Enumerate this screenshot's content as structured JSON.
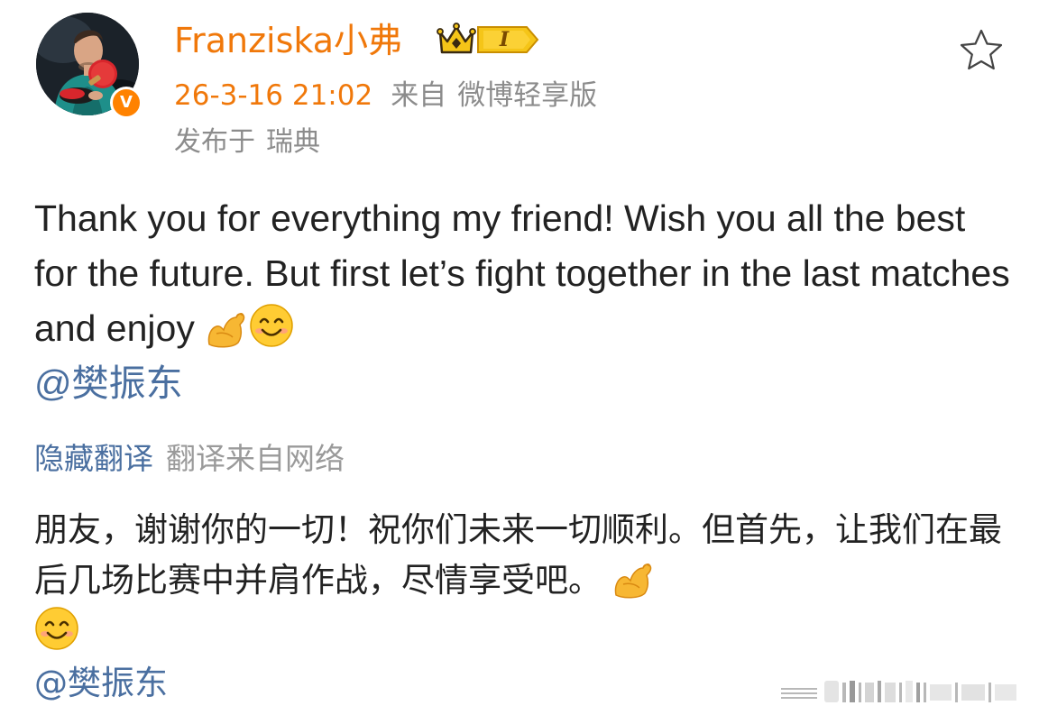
{
  "post": {
    "author": {
      "name": "Franziska小弗",
      "verified_mark": "V",
      "vip_level": "I",
      "avatar": "avatar-photo",
      "verified_icon": "verified-v-icon",
      "vip_icon": "crown-icon"
    },
    "timestamp": "26-3-16 21:02",
    "source_prefix": "来自",
    "source_app": "微博轻享版",
    "location_label": "发布于",
    "location": "瑞典",
    "more_icon": "star-outline-icon",
    "text": "Thank you for everything my friend! Wish you all the best for the future. But first let’s fight together in the last matches and enjoy",
    "emojis": [
      "flexed-biceps-emoji",
      "smiling-face-emoji"
    ],
    "mention": "@樊振东"
  },
  "translation": {
    "hide_label": "隐藏翻译",
    "source_note": "翻译来自网络",
    "text": "朋友，谢谢你的一切！祝你们未来一切顺利。但首先，让我们在最后几场比赛中并肩作战，尽情享受吧。",
    "mention": "@樊振东"
  },
  "colors": {
    "accent_orange": "#f0780a",
    "link_blue": "#4a6fa0",
    "meta_gray": "#8c8c8c",
    "verified_orange": "#ff8200",
    "vip_gold": "#f5c518"
  }
}
